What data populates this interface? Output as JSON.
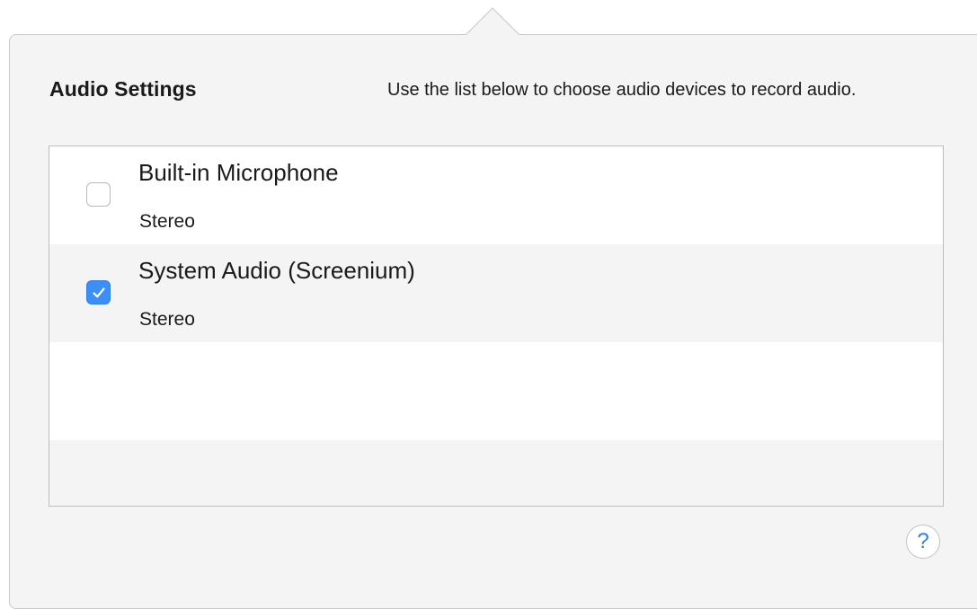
{
  "panel": {
    "title": "Audio Settings",
    "description": "Use the list below to choose audio devices to record audio."
  },
  "devices": [
    {
      "name": "Built-in Microphone",
      "channel": "Stereo",
      "checked": false
    },
    {
      "name": "System Audio (Screenium)",
      "channel": "Stereo",
      "checked": true
    }
  ],
  "help": {
    "label": "?",
    "icon": "question-mark-icon"
  },
  "colors": {
    "accent": "#3b8ff6",
    "panel_bg": "#f4f4f4",
    "help_glyph": "#2f7ef0"
  }
}
